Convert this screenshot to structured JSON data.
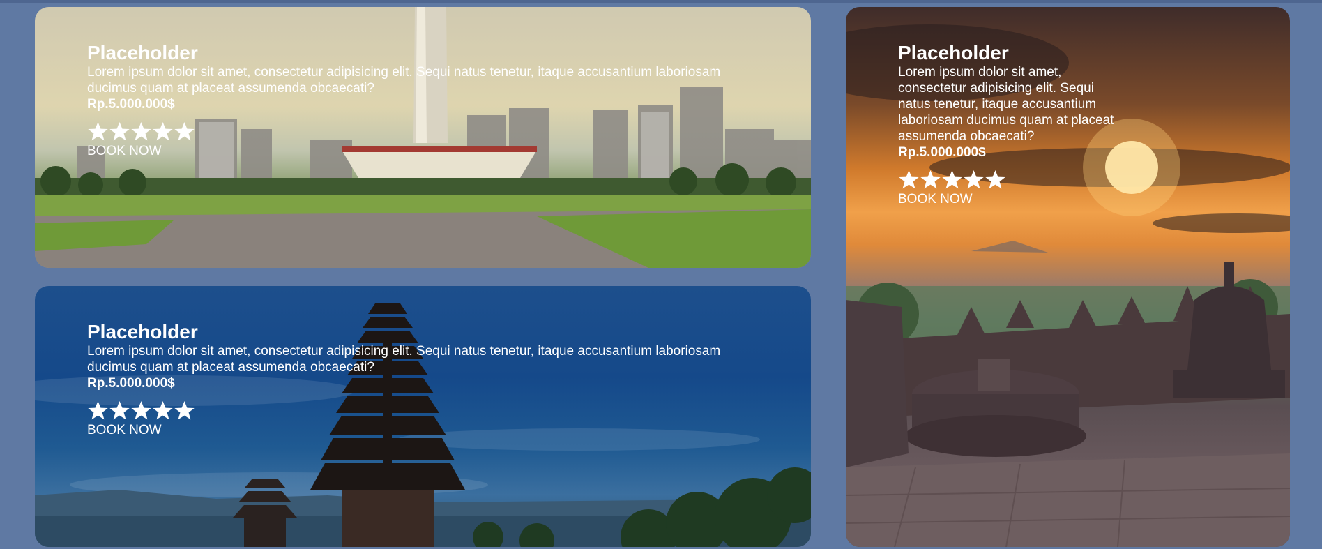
{
  "cards": [
    {
      "title": "Placeholder",
      "description": "Lorem ipsum dolor sit amet, consectetur adipisicing elit. Sequi natus tenetur, itaque accusantium laboriosam ducimus quam at placeat assumenda obcaecati?",
      "price": "Rp.5.000.000$",
      "rating": 5,
      "cta": "BOOK NOW",
      "image": "jakarta-monas-photo"
    },
    {
      "title": "Placeholder",
      "description": "Lorem ipsum dolor sit amet, consectetur adipisicing elit. Sequi natus tenetur, itaque accusantium laboriosam ducimus quam at placeat assumenda obcaecati?",
      "price": "Rp.5.000.000$",
      "rating": 5,
      "cta": "BOOK NOW",
      "image": "bali-temple-photo"
    },
    {
      "title": "Placeholder",
      "description": "Lorem ipsum dolor sit amet, consectetur adipisicing elit. Sequi natus tenetur, itaque accusantium laboriosam ducimus quam at placeat assumenda obcaecati?",
      "price": "Rp.5.000.000$",
      "rating": 5,
      "cta": "BOOK NOW",
      "image": "borobudur-sunset-photo"
    }
  ],
  "colors": {
    "page_background": "#5f79a3",
    "text": "#ffffff",
    "star": "#ffffff"
  },
  "icons": {
    "star": "star-icon"
  }
}
